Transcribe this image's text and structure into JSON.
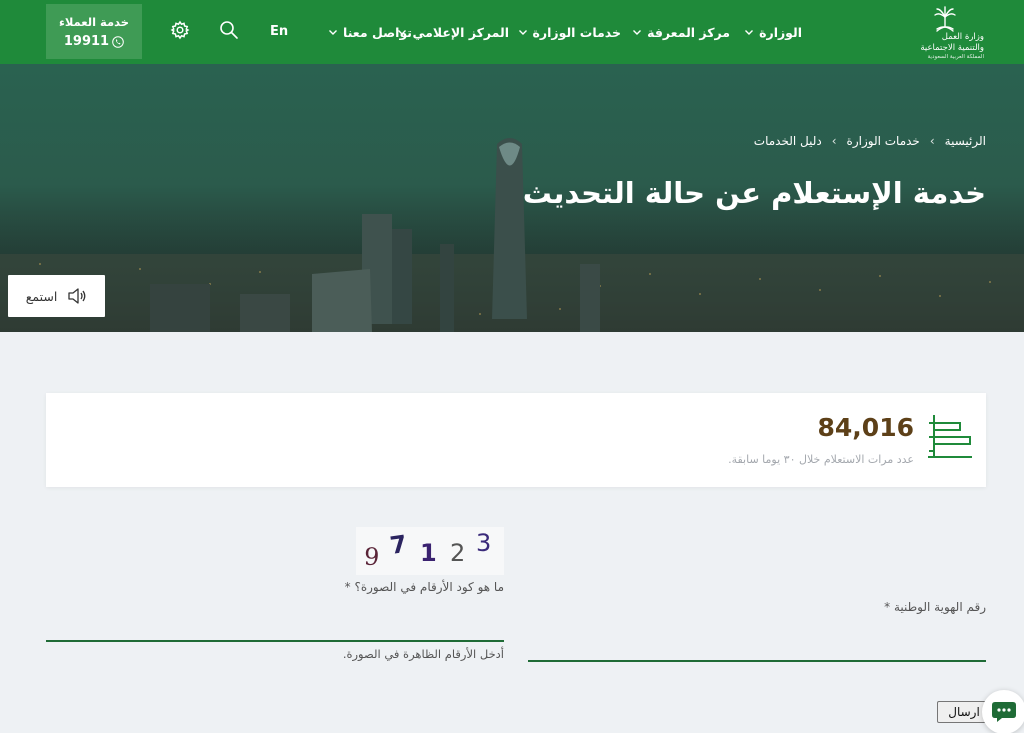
{
  "nav": {
    "logo": {
      "line1": "وزارة العمل",
      "line2": "والتنمية الاجتماعية",
      "line3": "المملكة العربية السعودية"
    },
    "items": [
      {
        "label": "الوزارة"
      },
      {
        "label": "مركز المعرفة"
      },
      {
        "label": "خدمات الوزارة"
      },
      {
        "label": "المركز الإعلامي"
      },
      {
        "label": "تواصل معنا"
      }
    ],
    "lang": "En",
    "customer_service": {
      "title": "خدمة العملاء",
      "number": "19911"
    }
  },
  "hero": {
    "breadcrumb": [
      "الرئيسية",
      "خدمات الوزارة",
      "دليل الخدمات"
    ],
    "title": "خدمة الإستعلام عن حالة التحديث",
    "listen_label": "استمع"
  },
  "stats": {
    "value": "84,016",
    "description": "عدد مرات الاستعلام خلال ٣٠ يوما سابقة."
  },
  "form": {
    "captcha_digits": [
      "9",
      "7",
      "1",
      "2",
      "3"
    ],
    "captcha_label": "ما هو كود الأرقام في الصورة؟ *",
    "captcha_hint": "أدخل الأرقام الظاهرة في الصورة.",
    "id_label": "رقم الهوية الوطنية *",
    "submit_label": "ارسال"
  },
  "colors": {
    "nav": "#1f8a3a",
    "accent": "#1f6b36",
    "stat_value": "#5d4018"
  }
}
